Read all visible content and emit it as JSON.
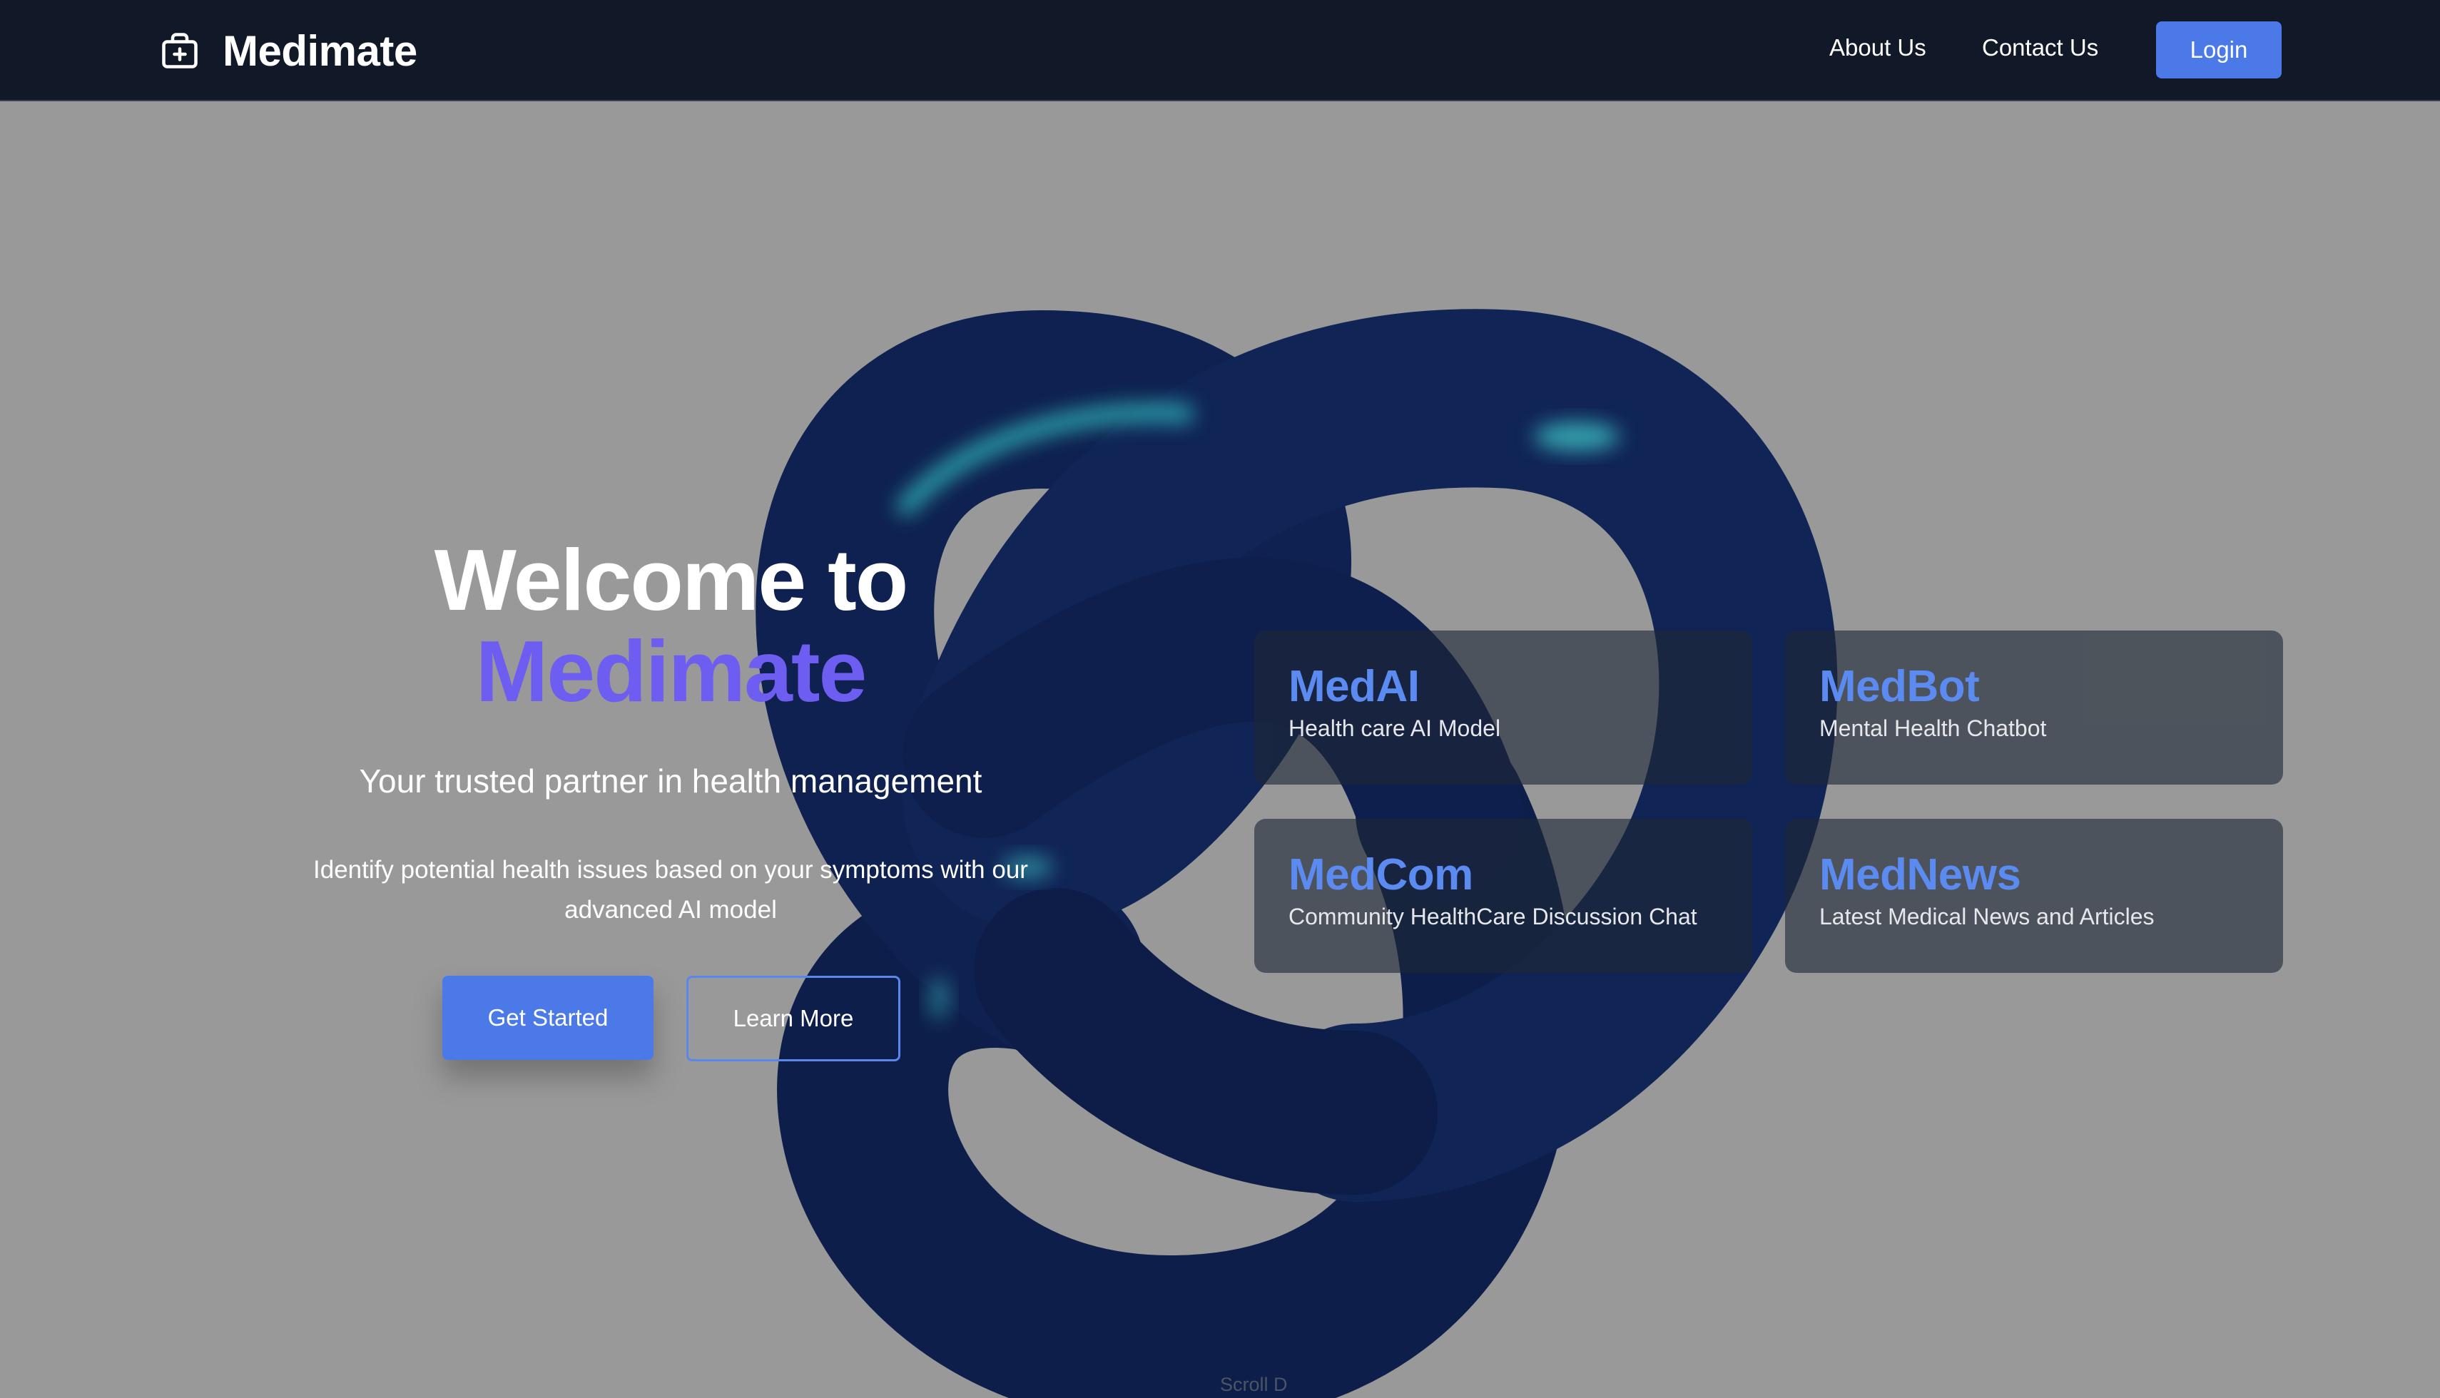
{
  "nav": {
    "brand": "Medimate",
    "brand_icon": "medical-kit-icon",
    "links": [
      "About Us",
      "Contact Us"
    ],
    "login_label": "Login"
  },
  "hero": {
    "title_line1": "Welcome to",
    "title_line2": "Medimate",
    "subtitle": "Your trusted partner in health management",
    "description": "Identify potential health issues based on your symptoms with our advanced AI model",
    "primary_button": "Get Started",
    "secondary_button": "Learn More"
  },
  "features": [
    {
      "title": "MedAI",
      "description": "Health care AI Model"
    },
    {
      "title": "MedBot",
      "description": "Mental Health Chatbot"
    },
    {
      "title": "MedCom",
      "description": "Community HealthCare Discussion Chat"
    },
    {
      "title": "MedNews",
      "description": "Latest Medical News and Articles"
    }
  ],
  "scroll_hint": "Scroll D",
  "colors": {
    "navbar_bg": "#111827",
    "page_bg": "#999999",
    "accent_blue": "#4b7ae8",
    "title_purple": "#6d5df0",
    "card_title_blue": "#5b8af0",
    "knot_navy": "#0f2150"
  }
}
